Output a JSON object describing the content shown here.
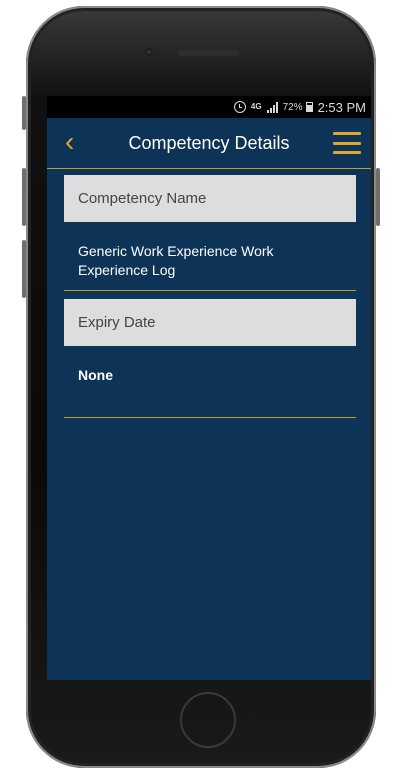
{
  "status_bar": {
    "network": "4G",
    "battery": "72%",
    "time": "2:53 PM"
  },
  "header": {
    "title": "Competency Details"
  },
  "fields": [
    {
      "label": "Competency Name",
      "value": "Generic Work Experience Work Experience Log"
    },
    {
      "label": "Expiry Date",
      "value": "None"
    }
  ],
  "colors": {
    "background": "#0d3356",
    "accent": "#e0a630",
    "section_header": "#dddddd"
  }
}
